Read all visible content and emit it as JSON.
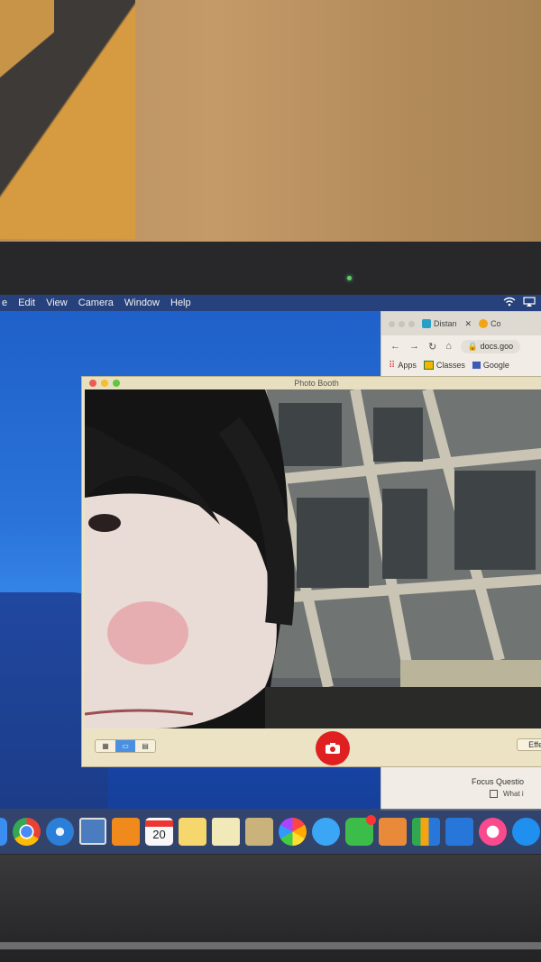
{
  "menubar": {
    "items": [
      "e",
      "Edit",
      "View",
      "Camera",
      "Window",
      "Help"
    ],
    "status_icons": [
      "wifi-icon",
      "airplay-icon"
    ]
  },
  "chrome": {
    "tabs": [
      {
        "label": "Distan",
        "icon": "google-classroom-icon",
        "color": "#27a0c6"
      },
      {
        "label": "Co",
        "icon": "slides-icon",
        "color": "#f4a313"
      }
    ],
    "url": "docs.goo",
    "bookmarks": [
      {
        "label": "Apps",
        "icon": "apps-grid-icon"
      },
      {
        "label": "Classes",
        "icon": "classroom-icon"
      },
      {
        "label": "Google",
        "icon": "google-icon"
      }
    ],
    "doc_heading": "Focus Questio",
    "doc_item": "What i"
  },
  "photobooth": {
    "title": "Photo Booth",
    "effects_label": "Effe",
    "layout_buttons": [
      "grid-layout",
      "single-layout",
      "filmstrip-layout"
    ],
    "selected_layout": "single-layout"
  },
  "dock": {
    "icons": [
      {
        "name": "finder-icon",
        "color": "#3a8ef0"
      },
      {
        "name": "chrome-icon",
        "color": "#e0e0e0"
      },
      {
        "name": "safari-icon",
        "color": "#2b7fd8"
      },
      {
        "name": "preview-icon",
        "color": "#4c7cc0"
      },
      {
        "name": "pages-icon",
        "color": "#f08a1c"
      },
      {
        "name": "calendar-icon",
        "color": "#f7f7f7"
      },
      {
        "name": "notes-icon",
        "color": "#f5d76e"
      },
      {
        "name": "textedit-icon",
        "color": "#f1e9b8"
      },
      {
        "name": "preview2-icon",
        "color": "#c9b37a"
      },
      {
        "name": "photos-icon",
        "color": "#f4f4f4"
      },
      {
        "name": "messages-icon",
        "color": "#3aa6f5"
      },
      {
        "name": "facetime-icon",
        "color": "#3cbd4a"
      },
      {
        "name": "pages2-icon",
        "color": "#e98a3a"
      },
      {
        "name": "numbers-icon",
        "color": "#2fa84f"
      },
      {
        "name": "keynote-icon",
        "color": "#2677d9"
      },
      {
        "name": "itunes-icon",
        "color": "#f84a8c"
      },
      {
        "name": "appstore-icon",
        "color": "#1f8ff0"
      }
    ],
    "calendar_day": "20"
  }
}
